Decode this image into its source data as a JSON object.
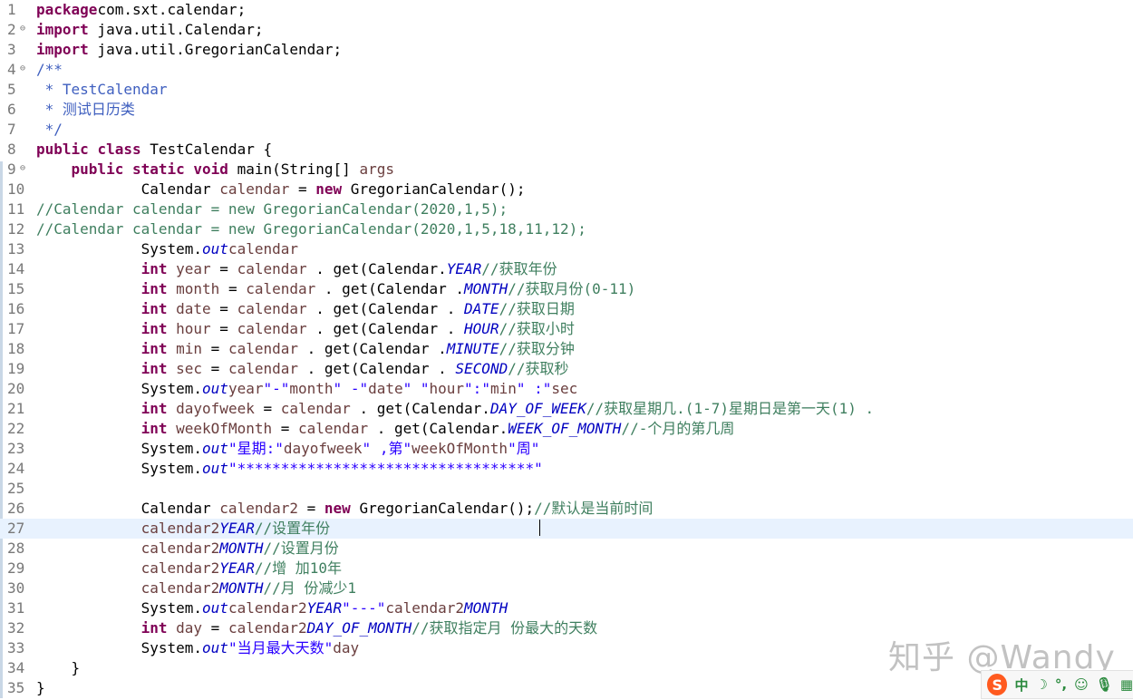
{
  "editor": {
    "lines": [
      {
        "n": "1",
        "segs": [
          [
            "kw",
            "package"
          ],
          [
            "",
            "com.sxt.calendar;"
          ]
        ]
      },
      {
        "n": "2",
        "fold": true,
        "segs": [
          [
            "kw",
            "import"
          ],
          [
            "",
            " java.util.Calendar;"
          ]
        ]
      },
      {
        "n": "3",
        "segs": [
          [
            "kw",
            "import"
          ],
          [
            "",
            " java.util.GregorianCalendar;"
          ]
        ]
      },
      {
        "n": "4",
        "fold": true,
        "segs": [
          [
            "jd",
            "/**"
          ]
        ]
      },
      {
        "n": "5",
        "segs": [
          [
            "jd",
            " * TestCalendar"
          ]
        ]
      },
      {
        "n": "6",
        "segs": [
          [
            "jd",
            " * 测试日历类"
          ]
        ]
      },
      {
        "n": "7",
        "segs": [
          [
            "jd",
            " */"
          ]
        ]
      },
      {
        "n": "8",
        "segs": [
          [
            "kw",
            "public"
          ],
          [
            "",
            " "
          ],
          [
            "kw",
            "class"
          ],
          [
            "",
            " TestCalendar {"
          ]
        ]
      },
      {
        "n": "9",
        "fold": true,
        "segs": [
          [
            "",
            "    "
          ],
          [
            "kw",
            "public"
          ],
          [
            "",
            " "
          ],
          [
            "kw",
            "static"
          ],
          [
            "",
            " "
          ],
          [
            "kw",
            "void"
          ],
          [
            "",
            " main(String[] "
          ],
          [
            "var",
            "args"
          ],
          [
            ") {"
          ]
        ]
      },
      {
        "n": "10",
        "segs": [
          [
            "",
            "            Calendar "
          ],
          [
            "var",
            "calendar"
          ],
          [
            "",
            " = "
          ],
          [
            "kw",
            "new"
          ],
          [
            "",
            " GregorianCalendar();"
          ]
        ]
      },
      {
        "n": "11",
        "segs": [
          [
            "cm",
            "//Calendar calendar = new GregorianCalendar(2020,1,5);"
          ]
        ]
      },
      {
        "n": "12",
        "segs": [
          [
            "cm",
            "//Calendar calendar = new GregorianCalendar(2020,1,5,18,11,12);"
          ]
        ]
      },
      {
        "n": "13",
        "segs": [
          [
            "",
            "            System."
          ],
          [
            "fld",
            "out"
          ],
          [
            ".println("
          ],
          [
            "var",
            "calendar"
          ],
          [
            ");"
          ]
        ]
      },
      {
        "n": "14",
        "segs": [
          [
            "",
            "            "
          ],
          [
            "kw",
            "int"
          ],
          [
            "",
            " "
          ],
          [
            "var",
            "year"
          ],
          [
            "",
            " = "
          ],
          [
            "var",
            "calendar"
          ],
          [
            "",
            " . get(Calendar."
          ],
          [
            "fld",
            "YEAR"
          ],
          [
            ");"
          ],
          [
            "cm",
            "//获取年份"
          ]
        ]
      },
      {
        "n": "15",
        "segs": [
          [
            "",
            "            "
          ],
          [
            "kw",
            "int"
          ],
          [
            "",
            " "
          ],
          [
            "var",
            "month"
          ],
          [
            "",
            " = "
          ],
          [
            "var",
            "calendar"
          ],
          [
            "",
            " . get(Calendar ."
          ],
          [
            "fld",
            "MONTH"
          ],
          [
            ") ;"
          ],
          [
            "cm",
            "//获取月份(0-11)"
          ]
        ]
      },
      {
        "n": "16",
        "segs": [
          [
            "",
            "            "
          ],
          [
            "kw",
            "int"
          ],
          [
            "",
            " "
          ],
          [
            "var",
            "date"
          ],
          [
            "",
            " = "
          ],
          [
            "var",
            "calendar"
          ],
          [
            "",
            " . get(Calendar . "
          ],
          [
            "fld",
            "DATE"
          ],
          [
            ");"
          ],
          [
            "cm",
            "//获取日期"
          ]
        ]
      },
      {
        "n": "17",
        "segs": [
          [
            "",
            "            "
          ],
          [
            "kw",
            "int"
          ],
          [
            "",
            " "
          ],
          [
            "var",
            "hour"
          ],
          [
            "",
            " = "
          ],
          [
            "var",
            "calendar"
          ],
          [
            "",
            " . get(Calendar . "
          ],
          [
            "fld",
            "HOUR"
          ],
          [
            ");"
          ],
          [
            "cm",
            "//获取小时"
          ]
        ]
      },
      {
        "n": "18",
        "segs": [
          [
            "",
            "            "
          ],
          [
            "kw",
            "int"
          ],
          [
            "",
            " "
          ],
          [
            "var",
            "min"
          ],
          [
            "",
            " = "
          ],
          [
            "var",
            "calendar"
          ],
          [
            "",
            " . get(Calendar ."
          ],
          [
            "fld",
            "MINUTE"
          ],
          [
            ");"
          ],
          [
            "cm",
            "//获取分钟"
          ]
        ]
      },
      {
        "n": "19",
        "segs": [
          [
            "",
            "            "
          ],
          [
            "kw",
            "int"
          ],
          [
            "",
            " "
          ],
          [
            "var",
            "sec"
          ],
          [
            "",
            " = "
          ],
          [
            "var",
            "calendar"
          ],
          [
            "",
            " . get(Calendar . "
          ],
          [
            "fld",
            "SECOND"
          ],
          [
            ");"
          ],
          [
            "cm",
            "//获取秒"
          ]
        ]
      },
      {
        "n": "20",
        "segs": [
          [
            "",
            "            System."
          ],
          [
            "fld",
            "out"
          ],
          [
            ". println("
          ],
          [
            "var",
            "year"
          ],
          [
            "+"
          ],
          [
            "str",
            "\"-\""
          ],
          [
            "+"
          ],
          [
            "var",
            "month"
          ],
          [
            "+"
          ],
          [
            "str",
            "\" -\""
          ],
          [
            "+"
          ],
          [
            "var",
            "date"
          ],
          [
            "+"
          ],
          [
            "str",
            "\" \""
          ],
          [
            "+"
          ],
          [
            "var",
            "hour"
          ],
          [
            "+"
          ],
          [
            "str",
            "\":\""
          ],
          [
            "+"
          ],
          [
            "var",
            "min"
          ],
          [
            "+"
          ],
          [
            "str",
            "\" :\""
          ],
          [
            "+"
          ],
          [
            "var",
            "sec"
          ],
          [
            ");"
          ]
        ]
      },
      {
        "n": "21",
        "segs": [
          [
            "",
            "            "
          ],
          [
            "kw",
            "int"
          ],
          [
            "",
            " "
          ],
          [
            "var",
            "dayofweek"
          ],
          [
            "",
            " = "
          ],
          [
            "var",
            "calendar"
          ],
          [
            "",
            " . get(Calendar."
          ],
          [
            "fld",
            "DAY_OF_WEEK"
          ],
          [
            ");"
          ],
          [
            "cm",
            "//获取星期几.(1-7)星期日是第一天(1) ."
          ]
        ]
      },
      {
        "n": "22",
        "segs": [
          [
            "",
            "            "
          ],
          [
            "kw",
            "int"
          ],
          [
            "",
            " "
          ],
          [
            "var",
            "weekOfMonth"
          ],
          [
            "",
            " = "
          ],
          [
            "var",
            "calendar"
          ],
          [
            "",
            " . get(Calendar."
          ],
          [
            "fld",
            "WEEK_OF_MONTH"
          ],
          [
            ");"
          ],
          [
            "cm",
            "//-个月的第几周"
          ]
        ]
      },
      {
        "n": "23",
        "segs": [
          [
            "",
            "            System."
          ],
          [
            "fld",
            "out"
          ],
          [
            ".println("
          ],
          [
            "str",
            "\"星期:\""
          ],
          [
            "+"
          ],
          [
            "var",
            "dayofweek"
          ],
          [
            "+"
          ],
          [
            "str",
            "\" ,第\""
          ],
          [
            "+"
          ],
          [
            "var",
            "weekOfMonth"
          ],
          [
            "+"
          ],
          [
            "str",
            "\"周\""
          ],
          [
            ");"
          ]
        ]
      },
      {
        "n": "24",
        "segs": [
          [
            "",
            "            System."
          ],
          [
            "fld",
            "out"
          ],
          [
            ".println("
          ],
          [
            "str",
            "\"**********************************\""
          ],
          [
            ");"
          ]
        ]
      },
      {
        "n": "25",
        "segs": []
      },
      {
        "n": "26",
        "segs": [
          [
            "",
            "            Calendar "
          ],
          [
            "var",
            "calendar2"
          ],
          [
            "",
            " = "
          ],
          [
            "kw",
            "new"
          ],
          [
            "",
            " GregorianCalendar();"
          ],
          [
            "cm",
            "//默认是当前时间"
          ]
        ]
      },
      {
        "n": "27",
        "current": true,
        "segs": [
          [
            "",
            "            "
          ],
          [
            "var",
            "calendar2"
          ],
          [
            ".set(Calendar."
          ],
          [
            "fld",
            "YEAR"
          ],
          [
            ", 2050);"
          ],
          [
            "cm",
            "//设置年份"
          ]
        ]
      },
      {
        "n": "28",
        "segs": [
          [
            "",
            "            "
          ],
          [
            "var",
            "calendar2"
          ],
          [
            ".set(Calendar."
          ],
          [
            "fld",
            "MONTH"
          ],
          [
            ", 3);"
          ],
          [
            "cm",
            "//设置月份"
          ]
        ]
      },
      {
        "n": "29",
        "segs": [
          [
            "",
            "            "
          ],
          [
            "var",
            "calendar2"
          ],
          [
            ".add(Calendar."
          ],
          [
            "fld",
            "YEAR"
          ],
          [
            ", 10);"
          ],
          [
            "cm",
            "//增 加10年"
          ]
        ]
      },
      {
        "n": "30",
        "segs": [
          [
            "",
            "            "
          ],
          [
            "var",
            "calendar2"
          ],
          [
            ".add(Calendar."
          ],
          [
            "fld",
            "MONTH"
          ],
          [
            ", -1);"
          ],
          [
            "cm",
            "//月 份减少1"
          ]
        ]
      },
      {
        "n": "31",
        "segs": [
          [
            "",
            "            System."
          ],
          [
            "fld",
            "out"
          ],
          [
            ".println("
          ],
          [
            "var",
            "calendar2"
          ],
          [
            ".get(Calendar."
          ],
          [
            "fld",
            "YEAR"
          ],
          [
            ")+"
          ],
          [
            "str",
            "\"---\""
          ],
          [
            "+"
          ],
          [
            "var",
            "calendar2"
          ],
          [
            ".get(Calendar."
          ],
          [
            "fld",
            "MONTH"
          ],
          [
            "));"
          ]
        ]
      },
      {
        "n": "32",
        "segs": [
          [
            "",
            "            "
          ],
          [
            "kw",
            "int"
          ],
          [
            "",
            " "
          ],
          [
            "var",
            "day"
          ],
          [
            "",
            " = "
          ],
          [
            "var",
            "calendar2"
          ],
          [
            ".getActualMaximum(Calendar."
          ],
          [
            "fld",
            "DAY_OF_MONTH"
          ],
          [
            ");"
          ],
          [
            "cm",
            "//获取指定月 份最大的天数"
          ]
        ]
      },
      {
        "n": "33",
        "segs": [
          [
            "",
            "            System."
          ],
          [
            "fld",
            "out"
          ],
          [
            ".println("
          ],
          [
            "str",
            "\"当月最大天数\""
          ],
          [
            "+"
          ],
          [
            "var",
            "day"
          ],
          [
            ");"
          ]
        ]
      },
      {
        "n": "34",
        "segs": [
          [
            "",
            "    }"
          ]
        ]
      },
      {
        "n": "35",
        "segs": [
          [
            "",
            "}"
          ]
        ]
      }
    ]
  },
  "watermark": {
    "text": "知乎 @Wandy"
  },
  "ime": {
    "logo": "S",
    "mode": "中",
    "icons": [
      "moon-icon",
      "punctuation-icon",
      "emoji-icon",
      "mic-icon",
      "keyboard-icon"
    ],
    "glyphs": [
      "☽",
      "°,",
      "☺",
      "🎙",
      "▦"
    ]
  },
  "colors": {
    "keyword": "#7f0055",
    "comment": "#3f7f5f",
    "javadoc": "#3f5fbf",
    "string": "#2a00ff",
    "field": "#0000c0",
    "local": "#6a3e3e",
    "current_line": "#e8f2fe"
  }
}
